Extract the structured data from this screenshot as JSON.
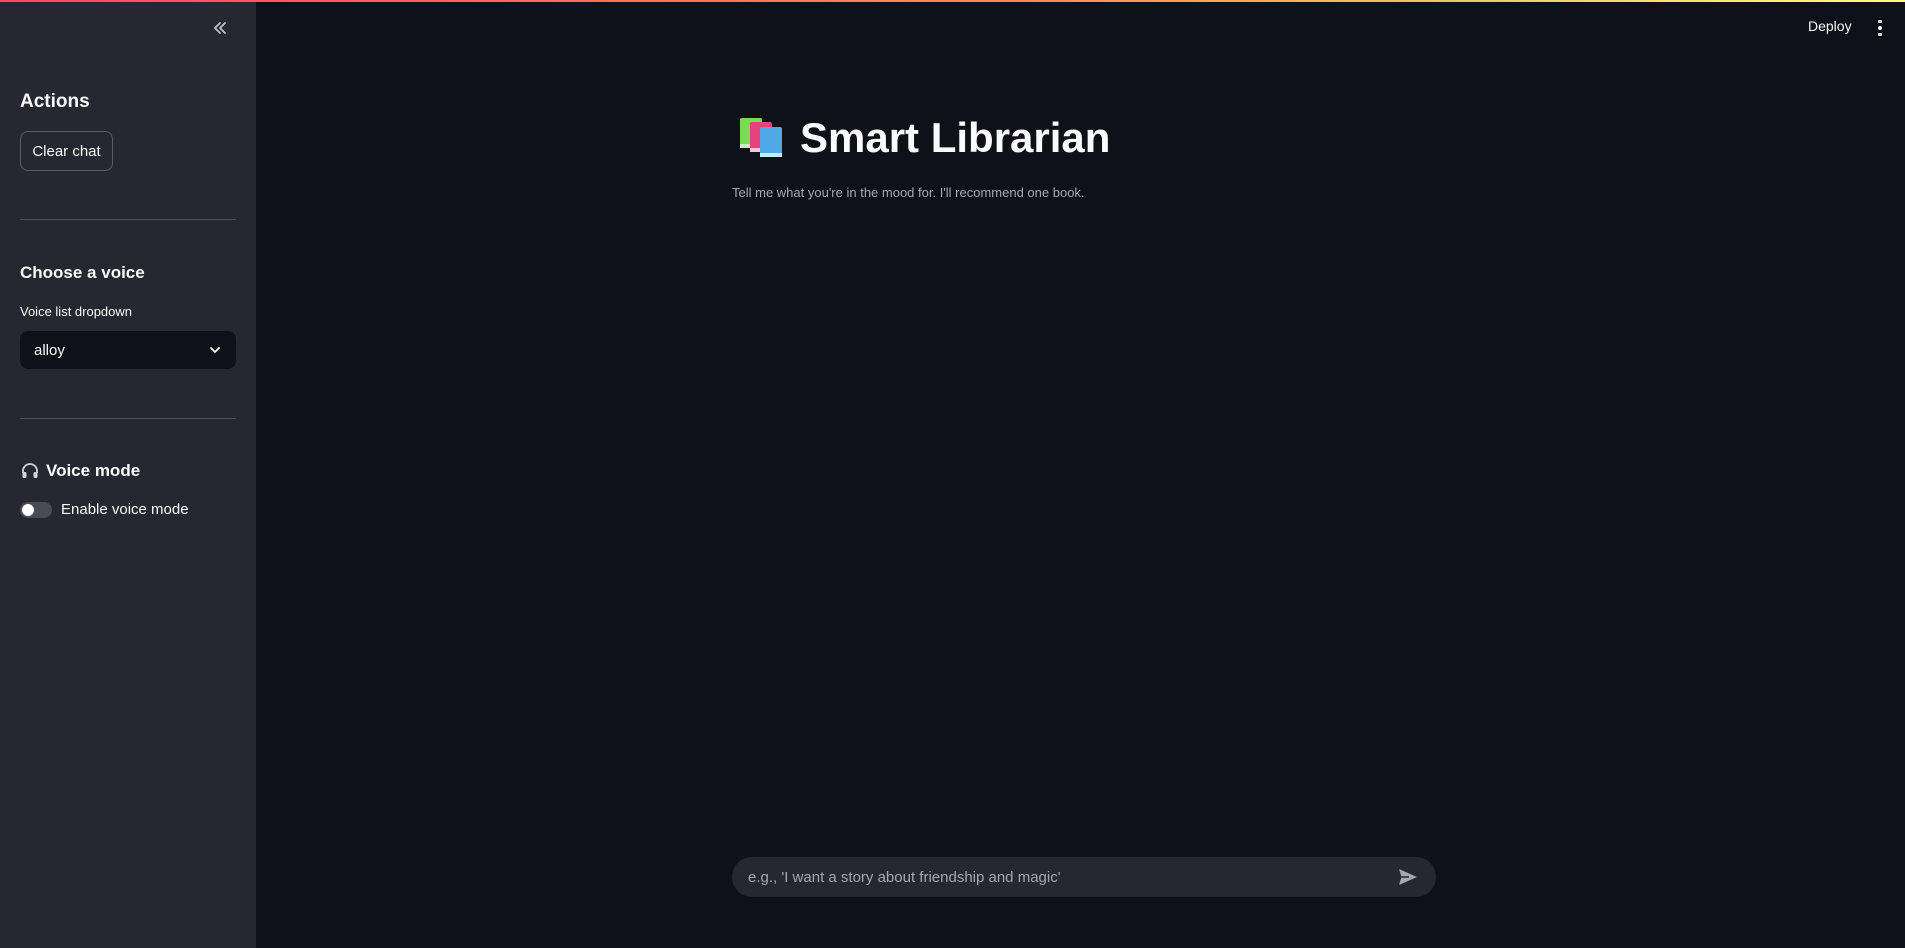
{
  "sidebar": {
    "actions_heading": "Actions",
    "clear_chat_label": "Clear chat",
    "voice_heading": "Choose a voice",
    "voice_dropdown_label": "Voice list dropdown",
    "voice_selected": "alloy",
    "voice_mode_heading": "Voice mode",
    "voice_mode_icon": "headphones-icon",
    "voice_mode_toggle_label": "Enable voice mode",
    "voice_mode_enabled": false
  },
  "header": {
    "deploy_label": "Deploy"
  },
  "main": {
    "title_icon": "books-icon",
    "title": "Smart Librarian",
    "subtitle": "Tell me what you're in the mood for. I'll recommend one book."
  },
  "chat": {
    "placeholder": "e.g., 'I want a story about friendship and magic'"
  },
  "colors": {
    "background": "#0e1117",
    "sidebar": "#262730",
    "text": "#fafafa",
    "muted_text": "#a3a8b4"
  }
}
